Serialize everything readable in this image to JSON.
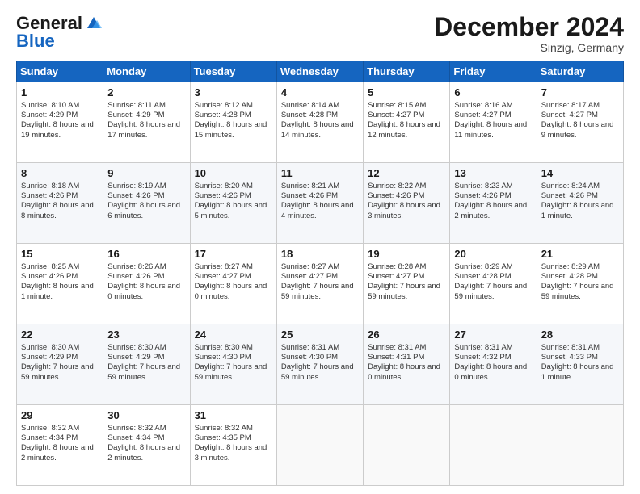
{
  "logo": {
    "line1": "General",
    "line2": "Blue"
  },
  "header": {
    "month": "December 2024",
    "location": "Sinzig, Germany"
  },
  "days_of_week": [
    "Sunday",
    "Monday",
    "Tuesday",
    "Wednesday",
    "Thursday",
    "Friday",
    "Saturday"
  ],
  "weeks": [
    [
      {
        "day": 1,
        "sunrise": "8:10 AM",
        "sunset": "4:29 PM",
        "daylight": "8 hours and 19 minutes."
      },
      {
        "day": 2,
        "sunrise": "8:11 AM",
        "sunset": "4:29 PM",
        "daylight": "8 hours and 17 minutes."
      },
      {
        "day": 3,
        "sunrise": "8:12 AM",
        "sunset": "4:28 PM",
        "daylight": "8 hours and 15 minutes."
      },
      {
        "day": 4,
        "sunrise": "8:14 AM",
        "sunset": "4:28 PM",
        "daylight": "8 hours and 14 minutes."
      },
      {
        "day": 5,
        "sunrise": "8:15 AM",
        "sunset": "4:27 PM",
        "daylight": "8 hours and 12 minutes."
      },
      {
        "day": 6,
        "sunrise": "8:16 AM",
        "sunset": "4:27 PM",
        "daylight": "8 hours and 11 minutes."
      },
      {
        "day": 7,
        "sunrise": "8:17 AM",
        "sunset": "4:27 PM",
        "daylight": "8 hours and 9 minutes."
      }
    ],
    [
      {
        "day": 8,
        "sunrise": "8:18 AM",
        "sunset": "4:26 PM",
        "daylight": "8 hours and 8 minutes."
      },
      {
        "day": 9,
        "sunrise": "8:19 AM",
        "sunset": "4:26 PM",
        "daylight": "8 hours and 6 minutes."
      },
      {
        "day": 10,
        "sunrise": "8:20 AM",
        "sunset": "4:26 PM",
        "daylight": "8 hours and 5 minutes."
      },
      {
        "day": 11,
        "sunrise": "8:21 AM",
        "sunset": "4:26 PM",
        "daylight": "8 hours and 4 minutes."
      },
      {
        "day": 12,
        "sunrise": "8:22 AM",
        "sunset": "4:26 PM",
        "daylight": "8 hours and 3 minutes."
      },
      {
        "day": 13,
        "sunrise": "8:23 AM",
        "sunset": "4:26 PM",
        "daylight": "8 hours and 2 minutes."
      },
      {
        "day": 14,
        "sunrise": "8:24 AM",
        "sunset": "4:26 PM",
        "daylight": "8 hours and 1 minute."
      }
    ],
    [
      {
        "day": 15,
        "sunrise": "8:25 AM",
        "sunset": "4:26 PM",
        "daylight": "8 hours and 1 minute."
      },
      {
        "day": 16,
        "sunrise": "8:26 AM",
        "sunset": "4:26 PM",
        "daylight": "8 hours and 0 minutes."
      },
      {
        "day": 17,
        "sunrise": "8:27 AM",
        "sunset": "4:27 PM",
        "daylight": "8 hours and 0 minutes."
      },
      {
        "day": 18,
        "sunrise": "8:27 AM",
        "sunset": "4:27 PM",
        "daylight": "7 hours and 59 minutes."
      },
      {
        "day": 19,
        "sunrise": "8:28 AM",
        "sunset": "4:27 PM",
        "daylight": "7 hours and 59 minutes."
      },
      {
        "day": 20,
        "sunrise": "8:29 AM",
        "sunset": "4:28 PM",
        "daylight": "7 hours and 59 minutes."
      },
      {
        "day": 21,
        "sunrise": "8:29 AM",
        "sunset": "4:28 PM",
        "daylight": "7 hours and 59 minutes."
      }
    ],
    [
      {
        "day": 22,
        "sunrise": "8:30 AM",
        "sunset": "4:29 PM",
        "daylight": "7 hours and 59 minutes."
      },
      {
        "day": 23,
        "sunrise": "8:30 AM",
        "sunset": "4:29 PM",
        "daylight": "7 hours and 59 minutes."
      },
      {
        "day": 24,
        "sunrise": "8:30 AM",
        "sunset": "4:30 PM",
        "daylight": "7 hours and 59 minutes."
      },
      {
        "day": 25,
        "sunrise": "8:31 AM",
        "sunset": "4:30 PM",
        "daylight": "7 hours and 59 minutes."
      },
      {
        "day": 26,
        "sunrise": "8:31 AM",
        "sunset": "4:31 PM",
        "daylight": "8 hours and 0 minutes."
      },
      {
        "day": 27,
        "sunrise": "8:31 AM",
        "sunset": "4:32 PM",
        "daylight": "8 hours and 0 minutes."
      },
      {
        "day": 28,
        "sunrise": "8:31 AM",
        "sunset": "4:33 PM",
        "daylight": "8 hours and 1 minute."
      }
    ],
    [
      {
        "day": 29,
        "sunrise": "8:32 AM",
        "sunset": "4:34 PM",
        "daylight": "8 hours and 2 minutes."
      },
      {
        "day": 30,
        "sunrise": "8:32 AM",
        "sunset": "4:34 PM",
        "daylight": "8 hours and 2 minutes."
      },
      {
        "day": 31,
        "sunrise": "8:32 AM",
        "sunset": "4:35 PM",
        "daylight": "8 hours and 3 minutes."
      },
      null,
      null,
      null,
      null
    ]
  ]
}
